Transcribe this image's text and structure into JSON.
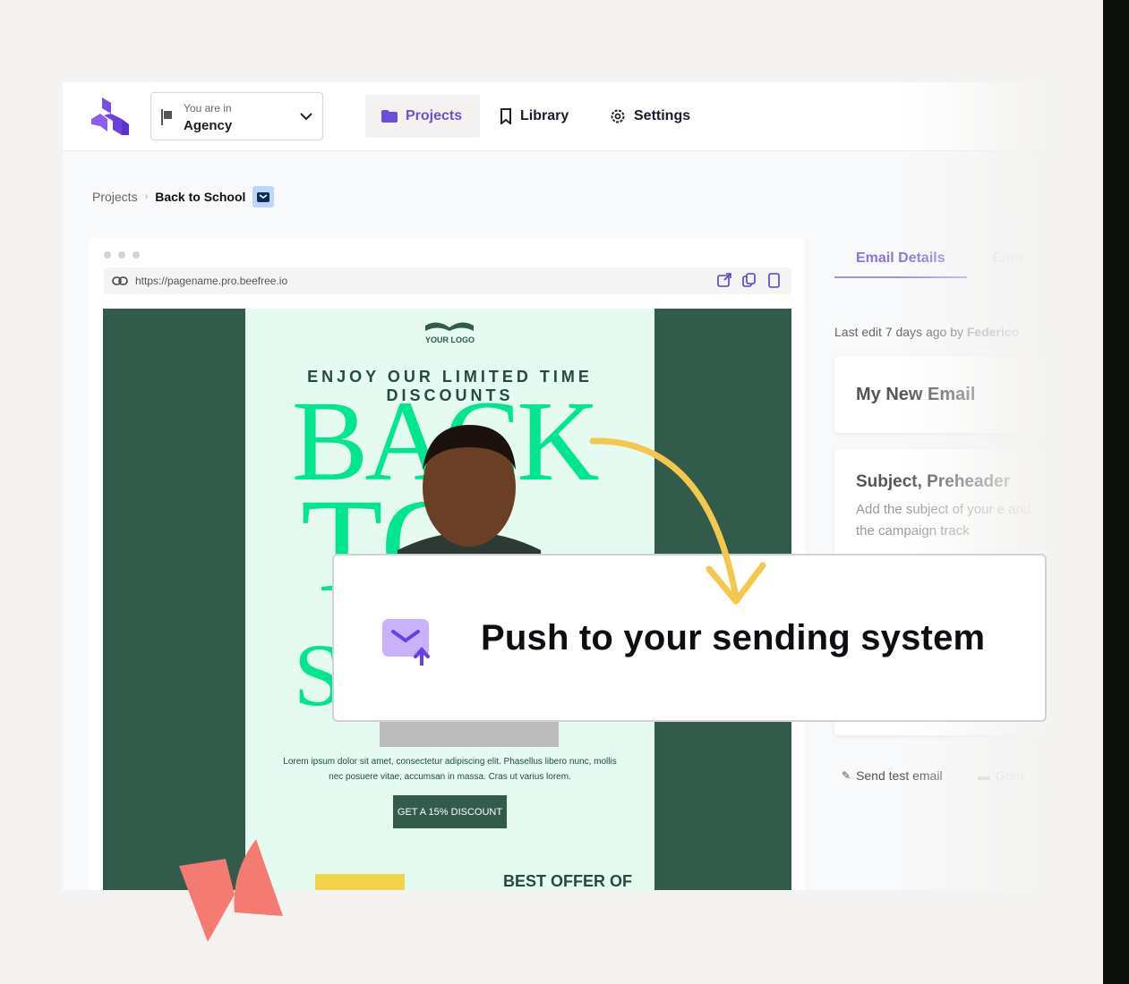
{
  "header": {
    "workspace_label": "You are in",
    "workspace_value": "Agency",
    "nav": [
      {
        "label": "Projects",
        "icon": "folder-icon",
        "active": true
      },
      {
        "label": "Library",
        "icon": "bookmark-icon"
      },
      {
        "label": "Settings",
        "icon": "gear-icon"
      }
    ]
  },
  "breadcrumb": {
    "root": "Projects",
    "current": "Back to School",
    "icon": "email-icon"
  },
  "preview": {
    "url": "https://pagename.pro.beefree.io",
    "email": {
      "logo_text": "YOUR LOGO",
      "tagline": "ENJOY OUR LIMITED TIME DISCOUNTS",
      "hero_words": [
        "BACK",
        "TO",
        "S"
      ],
      "body": "Lorem ipsum dolor sit amet, consectetur adipiscing elit. Phasellus libero nunc, mollis nec posuere vitae, accumsan in massa. Cras ut varius lorem.",
      "cta": "GET A 15% DISCOUNT",
      "section_title": "BEST OFFER OF THE"
    }
  },
  "details": {
    "tabs": [
      "Email Details",
      "Ema"
    ],
    "last_edit": "Last edit 7 days ago by ",
    "last_edit_user": "Federico",
    "name": "My New Email",
    "subject_title": "Subject, Preheader",
    "subject_desc": "Add the subject of your e and the campaign track",
    "send_test": "Send test email",
    "generate": "Gene"
  },
  "callout": {
    "text": "Push to your sending system",
    "icon": "email-push-icon"
  },
  "colors": {
    "accent": "#6b4fd6",
    "email_green": "#325b4c",
    "hero_green": "#00e68f",
    "arrow": "#f2c94c",
    "decor": "#f37b72"
  }
}
